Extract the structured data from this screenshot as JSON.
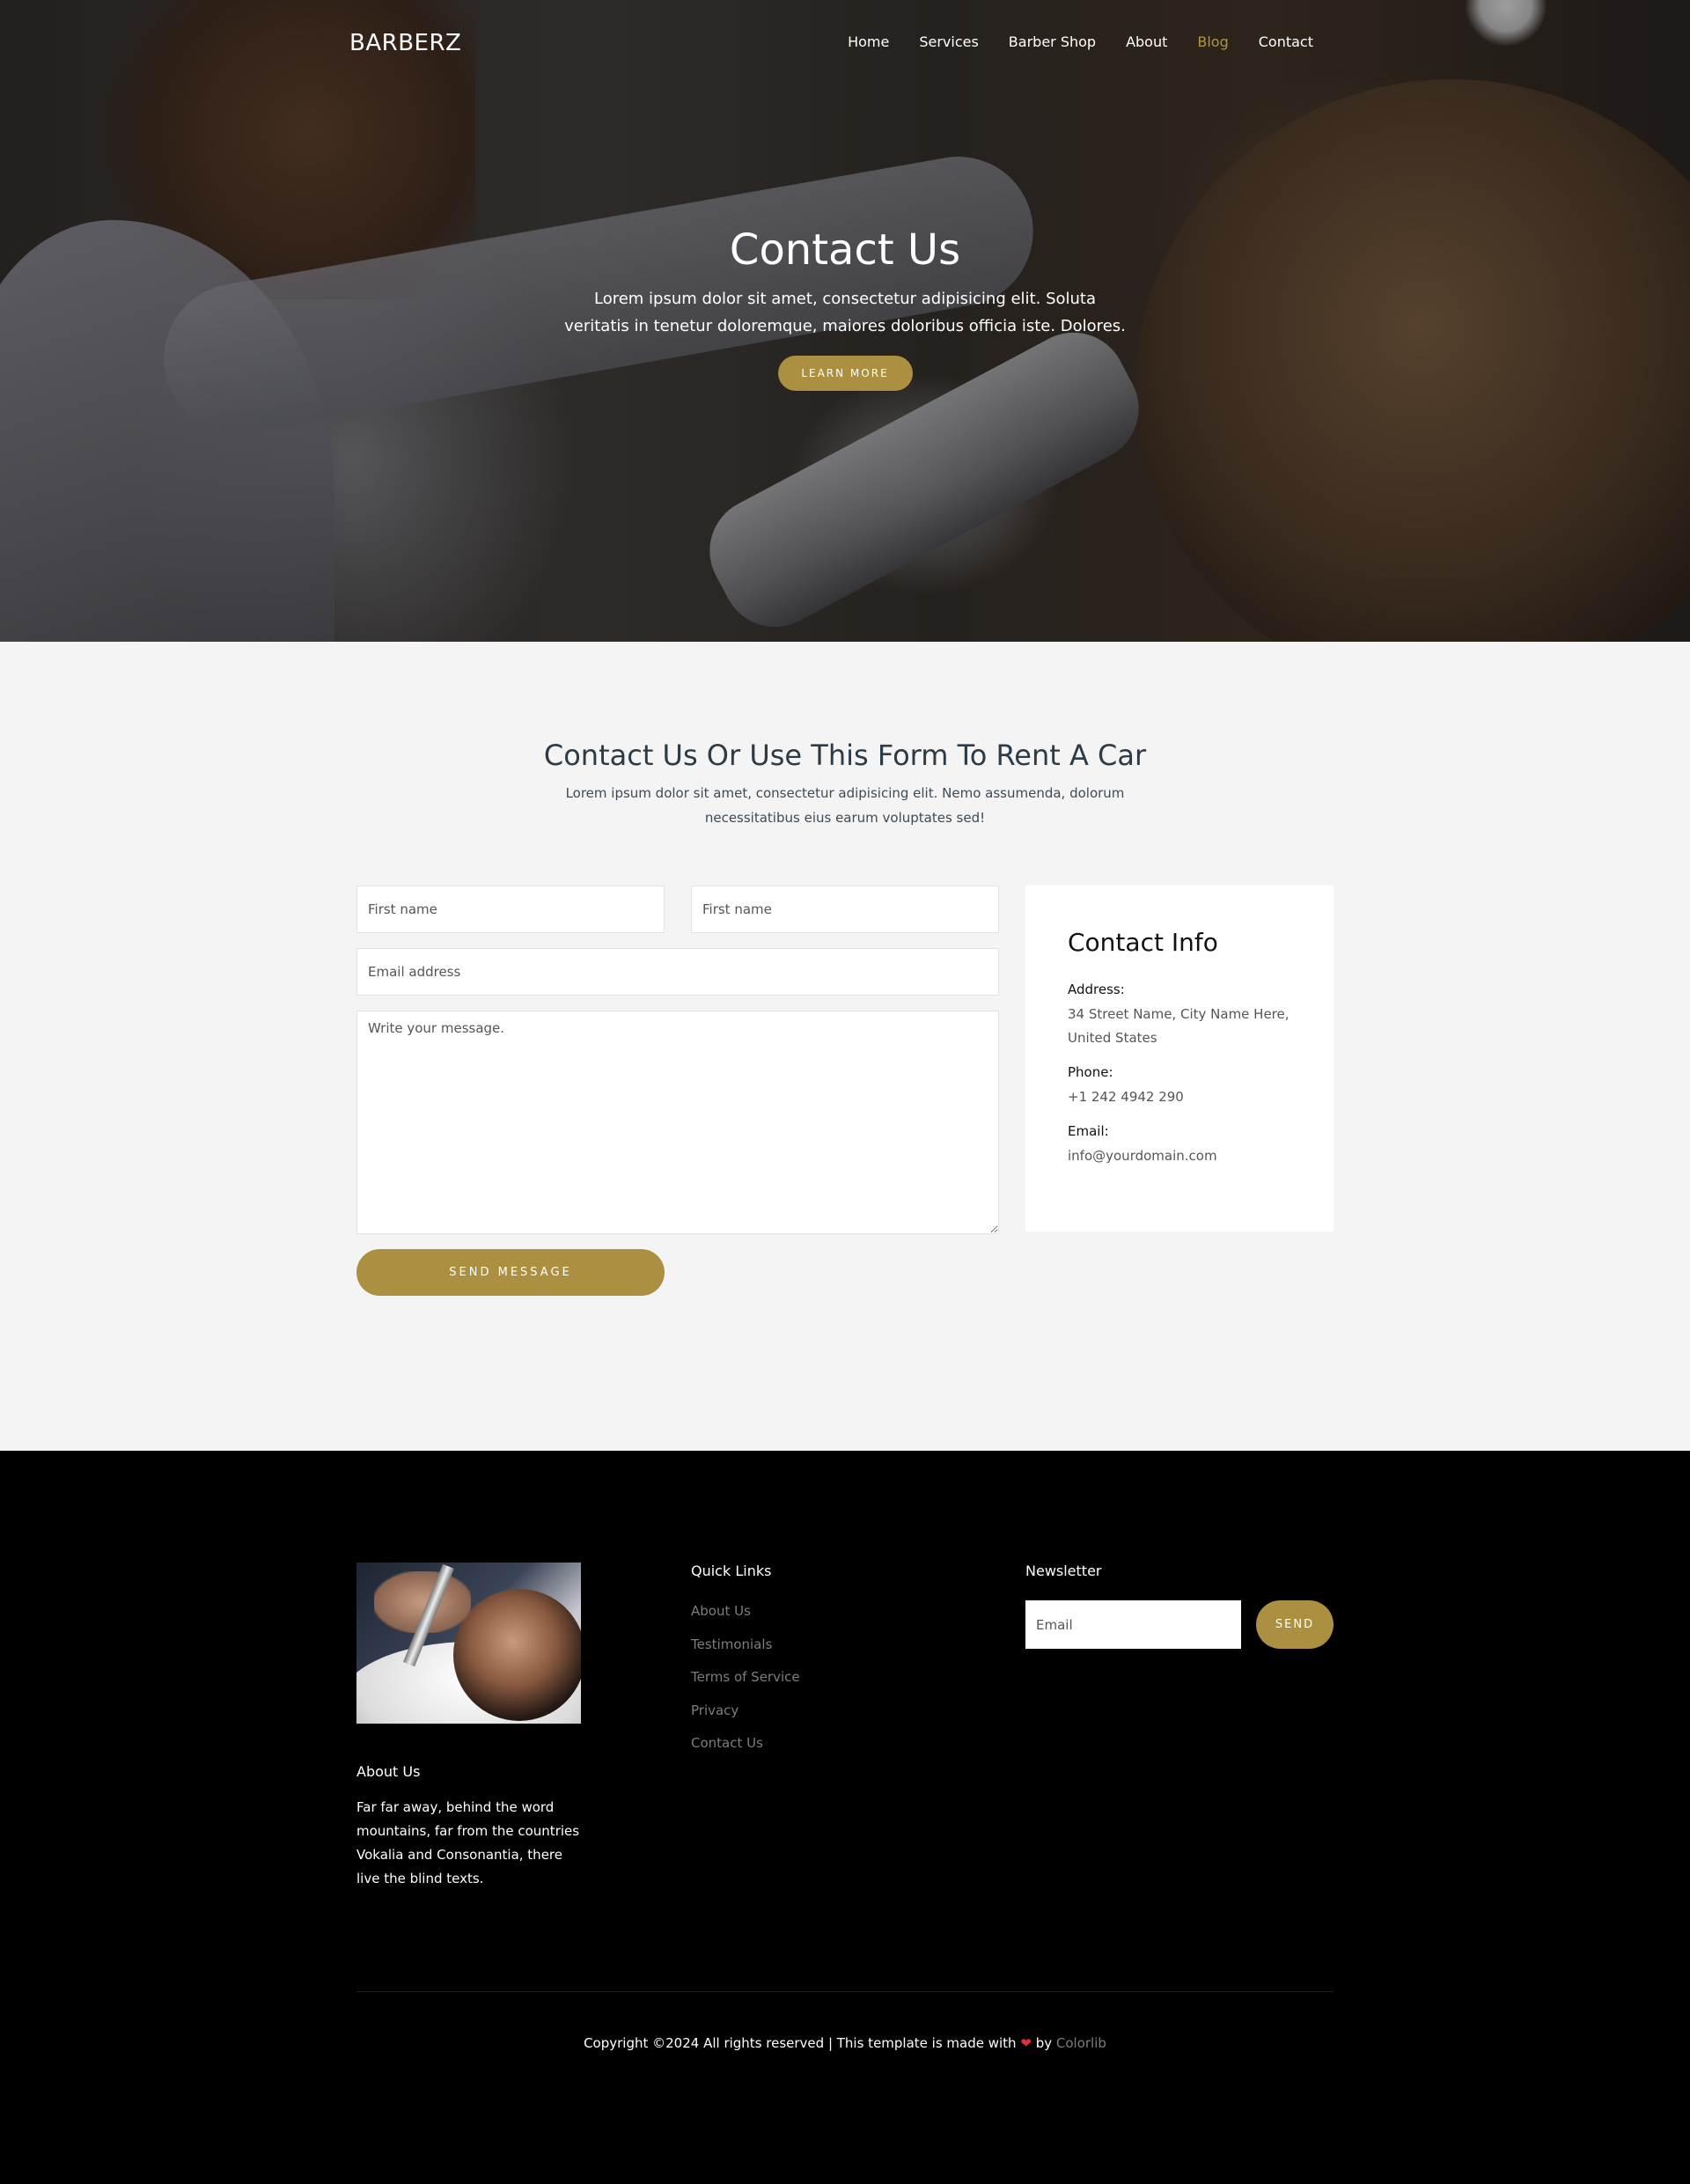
{
  "nav": {
    "brand": "BARBERZ",
    "items": [
      {
        "label": "Home"
      },
      {
        "label": "Services"
      },
      {
        "label": "Barber Shop"
      },
      {
        "label": "About"
      },
      {
        "label": "Blog",
        "active": true
      },
      {
        "label": "Contact"
      }
    ]
  },
  "hero": {
    "title": "Contact Us",
    "text": "Lorem ipsum dolor sit amet, consectetur adipisicing elit. Soluta veritatis in tenetur doloremque, maiores doloribus officia iste. Dolores.",
    "button": "Learn More"
  },
  "contact": {
    "title": "Contact Us Or Use This Form To Rent A Car",
    "subtitle": "Lorem ipsum dolor sit amet, consectetur adipisicing elit. Nemo assumenda, dolorum necessitatibus eius earum voluptates sed!",
    "form": {
      "first_name_placeholder": "First name",
      "second_name_placeholder": "First name",
      "email_placeholder": "Email address",
      "message_placeholder": "Write your message.",
      "send_label": "SEND MESSAGE"
    },
    "info": {
      "title": "Contact Info",
      "address_label": "Address:",
      "address_value": "34 Street Name, City Name Here, United States",
      "phone_label": "Phone:",
      "phone_value": "+1 242 4942 290",
      "email_label": "Email:",
      "email_value": "info@yourdomain.com"
    }
  },
  "footer": {
    "about_heading": "About Us",
    "about_text": "Far far away, behind the word mountains, far from the countries Vokalia and Consonantia, there live the blind texts.",
    "links_heading": "Quick Links",
    "links": [
      "About Us",
      "Testimonials",
      "Terms of Service",
      "Privacy",
      "Contact Us"
    ],
    "newsletter_heading": "Newsletter",
    "newsletter_placeholder": "Email",
    "newsletter_button": "SEND",
    "copyright_prefix": "Copyright ©2024 All rights reserved | This template is made with",
    "copyright_by": "by",
    "copyright_link": "Colorlib"
  },
  "colors": {
    "accent": "#ac9041",
    "nav_active": "#b39443",
    "heart": "#e0303f",
    "footer_bg": "#000000",
    "section_bg": "#f4f4f4"
  },
  "icons": {
    "heart": "heart-icon"
  }
}
